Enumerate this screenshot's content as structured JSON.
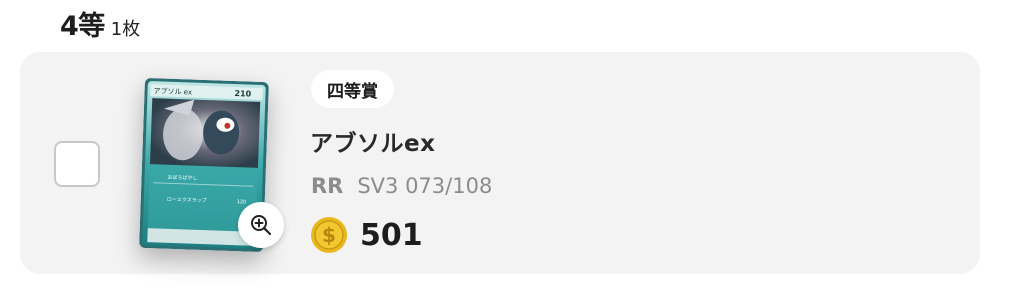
{
  "section": {
    "title": "4等",
    "count": "1枚"
  },
  "item": {
    "badge": "四等賞",
    "name": "アブソルex",
    "rarity": "RR",
    "set_number": "SV3 073/108",
    "price": "501"
  },
  "card_art": {
    "top_name": "アブソル ex",
    "hp": "210",
    "move1": "おぼろばやし",
    "move2": "ローエクスラップ",
    "damage": "120"
  },
  "colors": {
    "card_bg": "#f3f3f4",
    "coin": "#e8b81c",
    "card_teal": "#2f9ea0"
  },
  "icons": {
    "zoom": "zoom-in-icon",
    "coin": "coin-icon"
  }
}
